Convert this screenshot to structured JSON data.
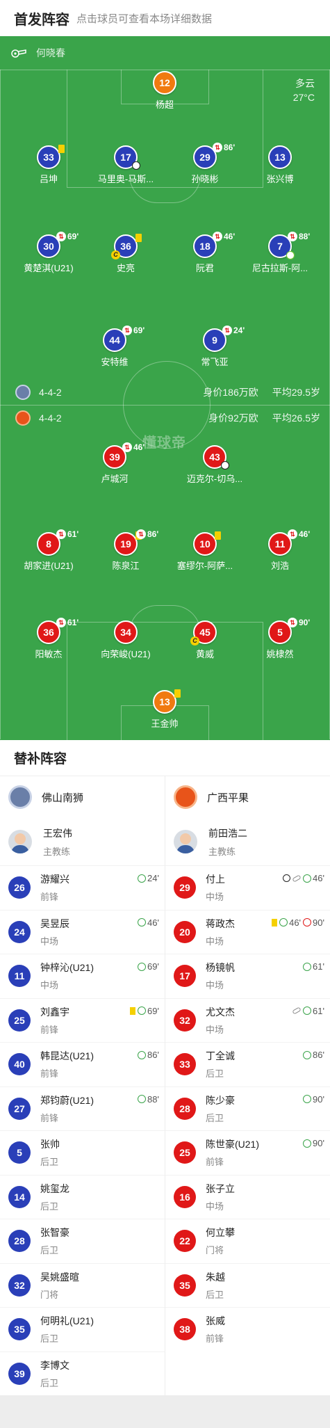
{
  "header": {
    "title": "首发阵容",
    "subtitle": "点击球员可查看本场详细数据"
  },
  "pitch": {
    "referee": "何晓春",
    "weather": "多云",
    "temperature": "27°C",
    "watermark": "懂球帝",
    "home": {
      "formation": "4-4-2",
      "value": "身价186万欧",
      "avg_age": "平均29.5岁"
    },
    "away": {
      "formation": "4-4-2",
      "value": "身价92万欧",
      "avg_age": "平均26.5岁"
    },
    "players": [
      {
        "num": "12",
        "name": "杨超"
      },
      {
        "num": "33",
        "name": "吕坤"
      },
      {
        "num": "17",
        "name": "马里奥-马斯..."
      },
      {
        "num": "29",
        "name": "孙晓彬",
        "minute": "86'"
      },
      {
        "num": "13",
        "name": "张兴博"
      },
      {
        "num": "30",
        "name": "黄楚淇(U21)",
        "minute": "69'"
      },
      {
        "num": "36",
        "name": "史亮"
      },
      {
        "num": "18",
        "name": "阮君",
        "minute": "46'"
      },
      {
        "num": "7",
        "name": "尼古拉斯-阿...",
        "minute": "88'"
      },
      {
        "num": "44",
        "name": "安特维",
        "minute": "69'"
      },
      {
        "num": "9",
        "name": "常飞亚",
        "minute": "24'"
      },
      {
        "num": "39",
        "name": "卢城河",
        "minute": "46'"
      },
      {
        "num": "43",
        "name": "迈克尔-切乌..."
      },
      {
        "num": "8",
        "name": "胡家进(U21)",
        "minute": "61'"
      },
      {
        "num": "19",
        "name": "陈泉江",
        "minute": "86'"
      },
      {
        "num": "10",
        "name": "塞缪尔-阿萨..."
      },
      {
        "num": "11",
        "name": "刘浩",
        "minute": "46'"
      },
      {
        "num": "36",
        "name": "阳敏杰",
        "minute": "61'"
      },
      {
        "num": "34",
        "name": "向荣峻(U21)"
      },
      {
        "num": "45",
        "name": "黄威"
      },
      {
        "num": "5",
        "name": "姚棣然",
        "minute": "90'"
      },
      {
        "num": "13",
        "name": "王金帅"
      }
    ]
  },
  "subs": {
    "title": "替补阵容",
    "home": {
      "team": "佛山南狮",
      "coach": {
        "name": "王宏伟",
        "role": "主教练"
      },
      "players": [
        {
          "num": "26",
          "name": "游耀兴",
          "pos": "前锋",
          "events": "24'"
        },
        {
          "num": "24",
          "name": "吴昱辰",
          "pos": "中场",
          "events": "46'"
        },
        {
          "num": "11",
          "name": "钟梓沁(U21)",
          "pos": "中场",
          "events": "69'"
        },
        {
          "num": "25",
          "name": "刘鑫宇",
          "pos": "前锋",
          "events": "69'"
        },
        {
          "num": "40",
          "name": "韩昆达(U21)",
          "pos": "前锋",
          "events": "86'"
        },
        {
          "num": "27",
          "name": "郑钧蔚(U21)",
          "pos": "前锋",
          "events": "88'"
        },
        {
          "num": "5",
          "name": "张帅",
          "pos": "后卫"
        },
        {
          "num": "14",
          "name": "姚玺龙",
          "pos": "后卫"
        },
        {
          "num": "28",
          "name": "张智豪",
          "pos": "后卫"
        },
        {
          "num": "32",
          "name": "吴姚盛暄",
          "pos": "门将"
        },
        {
          "num": "35",
          "name": "何明礼(U21)",
          "pos": "后卫"
        },
        {
          "num": "39",
          "name": "李博文",
          "pos": "后卫"
        }
      ]
    },
    "away": {
      "team": "广西平果",
      "coach": {
        "name": "前田浩二",
        "role": "主教练"
      },
      "players": [
        {
          "num": "29",
          "name": "付上",
          "pos": "中场",
          "events": "46'"
        },
        {
          "num": "20",
          "name": "蒋政杰",
          "pos": "中场",
          "events": "46'",
          "events2": "90'"
        },
        {
          "num": "17",
          "name": "杨镜帆",
          "pos": "中场",
          "events": "61'"
        },
        {
          "num": "32",
          "name": "尤文杰",
          "pos": "中场",
          "events": "61'"
        },
        {
          "num": "33",
          "name": "丁全诚",
          "pos": "后卫",
          "events": "86'"
        },
        {
          "num": "28",
          "name": "陈少豪",
          "pos": "后卫",
          "events": "90'"
        },
        {
          "num": "25",
          "name": "陈世豪(U21)",
          "pos": "前锋",
          "events": "90'"
        },
        {
          "num": "16",
          "name": "张子立",
          "pos": "中场"
        },
        {
          "num": "22",
          "name": "何立攀",
          "pos": "门将"
        },
        {
          "num": "35",
          "name": "朱越",
          "pos": "后卫"
        },
        {
          "num": "38",
          "name": "张威",
          "pos": "前锋"
        }
      ]
    }
  },
  "colors": {
    "pitch": "#3aa44a",
    "home": "#2a3fb8",
    "away": "#e01818",
    "keeper_home": "#f07a10"
  },
  "icons": {
    "referee": "whistle-icon",
    "goal": "ball-icon",
    "yellow": "yellow-card-icon",
    "sub_in": "sub-in-icon",
    "sub_out": "sub-out-icon"
  }
}
